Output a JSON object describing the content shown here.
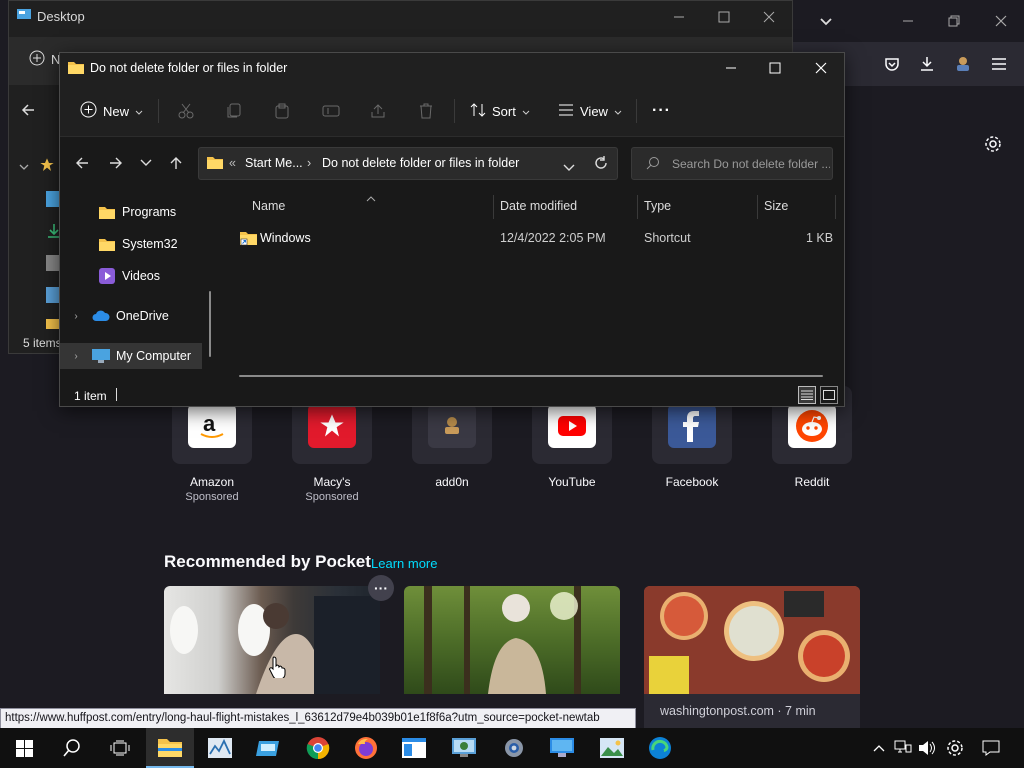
{
  "desktop_window": {
    "title": "Desktop",
    "new_label": "N",
    "status": "5 items"
  },
  "explorer": {
    "title": "Do not delete folder or files in folder",
    "toolbar": {
      "new_label": "New",
      "sort_label": "Sort",
      "view_label": "View",
      "more_label": "···"
    },
    "address": {
      "overflow": "«",
      "crumbs": [
        "Start Me...",
        "Do not delete folder or files in folder"
      ],
      "separator": "›"
    },
    "search_placeholder": "Search Do not delete folder ...",
    "nav_pane": [
      {
        "label": "Programs",
        "icon": "folder-icon"
      },
      {
        "label": "System32",
        "icon": "folder-icon"
      },
      {
        "label": "Videos",
        "icon": "videos-icon"
      },
      {
        "label": "OneDrive",
        "icon": "onedrive-icon"
      },
      {
        "label": "My Computer",
        "icon": "computer-icon"
      }
    ],
    "columns": [
      "Name",
      "Date modified",
      "Type",
      "Size"
    ],
    "files": [
      {
        "name": "Windows",
        "date": "12/4/2022 2:05 PM",
        "type": "Shortcut",
        "size": "1 KB"
      }
    ],
    "status": "1 item"
  },
  "firefox": {
    "top_sites": [
      {
        "label": "Amazon",
        "sub": "Sponsored"
      },
      {
        "label": "Macy's",
        "sub": "Sponsored"
      },
      {
        "label": "add0n",
        "sub": ""
      },
      {
        "label": "YouTube",
        "sub": ""
      },
      {
        "label": "Facebook",
        "sub": ""
      },
      {
        "label": "Reddit",
        "sub": ""
      }
    ],
    "pocket": {
      "title": "Recommended by Pocket",
      "learn_more": "Learn more",
      "card3_meta": "washingtonpost.com · 7 min"
    },
    "status_url": "https://www.huffpost.com/entry/long-haul-flight-mistakes_l_63612d79e4b039b01e1f8f6a?utm_source=pocket-newtab"
  },
  "colors": {
    "accent": "#76b9ed",
    "folder": "#f4c24b",
    "firefox_bg": "#1c1b22",
    "link": "#00ddff"
  }
}
